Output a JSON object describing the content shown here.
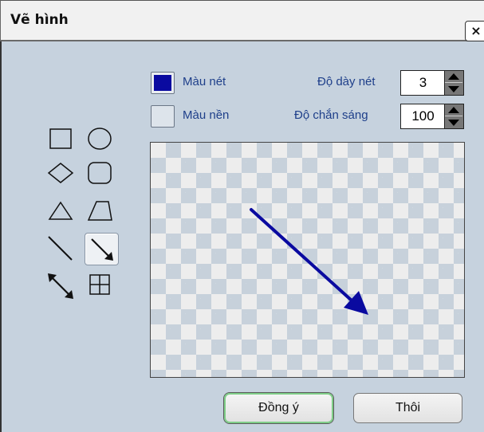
{
  "window": {
    "title": "Vẽ hình",
    "close_label": "×"
  },
  "stroke_color": {
    "label": "Màu nét",
    "value": "#0a0aa0"
  },
  "fill_color": {
    "label": "Màu nền",
    "value": "#dde4eb"
  },
  "stroke_width": {
    "label": "Độ dày nét",
    "value": "3"
  },
  "opacity": {
    "label": "Độ chắn sáng",
    "value": "100"
  },
  "tools": [
    {
      "name": "rectangle",
      "selected": false
    },
    {
      "name": "ellipse",
      "selected": false
    },
    {
      "name": "diamond",
      "selected": false
    },
    {
      "name": "rounded-rectangle",
      "selected": false
    },
    {
      "name": "triangle",
      "selected": false
    },
    {
      "name": "trapezoid",
      "selected": false
    },
    {
      "name": "line",
      "selected": false
    },
    {
      "name": "arrow",
      "selected": true
    },
    {
      "name": "double-arrow",
      "selected": false
    },
    {
      "name": "grid",
      "selected": false
    }
  ],
  "canvas": {
    "drawn_shape": "arrow",
    "stroke_color": "#0a0aa0"
  },
  "buttons": {
    "ok_label": "Đồng ý",
    "cancel_label": "Thôi"
  }
}
